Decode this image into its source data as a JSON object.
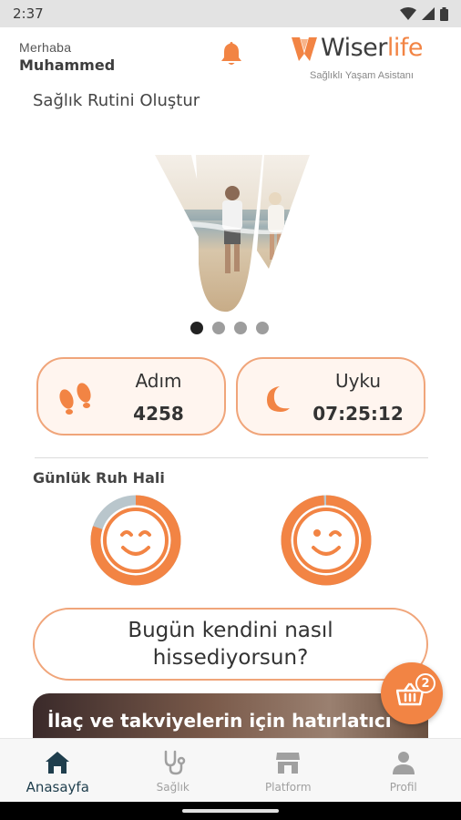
{
  "status_bar": {
    "time": "2:37"
  },
  "header": {
    "greeting": "Merhaba",
    "user_name": "Muhammed",
    "logo_part1": "Wiser",
    "logo_part2": "life",
    "logo_subtitle": "Sağlıklı Yaşam Asistanı"
  },
  "routine": {
    "title": "Sağlık Rutini Oluştur"
  },
  "carousel": {
    "page_count": 4,
    "active_index": 0
  },
  "metrics": {
    "steps": {
      "label": "Adım",
      "value": "4258",
      "icon": "footsteps-icon"
    },
    "sleep": {
      "label": "Uyku",
      "value": "07:25:12",
      "icon": "moon-icon"
    }
  },
  "mood": {
    "title": "Günlük Ruh Hali",
    "faces": [
      {
        "icon": "content-face-icon",
        "fill_fraction": 0.8
      },
      {
        "icon": "winking-face-icon",
        "fill_fraction": 0.99
      }
    ]
  },
  "feeling_prompt": {
    "text": "Bugün kendini nasıl hissediyorsun?"
  },
  "banner": {
    "text": "İlaç ve takviyelerin için hatırlatıcı"
  },
  "cart": {
    "count": "2"
  },
  "bottom_nav": [
    {
      "label": "Anasayfa",
      "icon": "home-icon",
      "active": true
    },
    {
      "label": "Sağlık",
      "icon": "stethoscope-icon",
      "active": false
    },
    {
      "label": "Platform",
      "icon": "store-icon",
      "active": false
    },
    {
      "label": "Profil",
      "icon": "person-icon",
      "active": false
    }
  ],
  "colors": {
    "accent": "#f28444",
    "accent_light": "#fff5ef",
    "border": "#f0a57a",
    "nav_active": "#1f3e4d",
    "nav_inactive": "#a0a0a0"
  }
}
